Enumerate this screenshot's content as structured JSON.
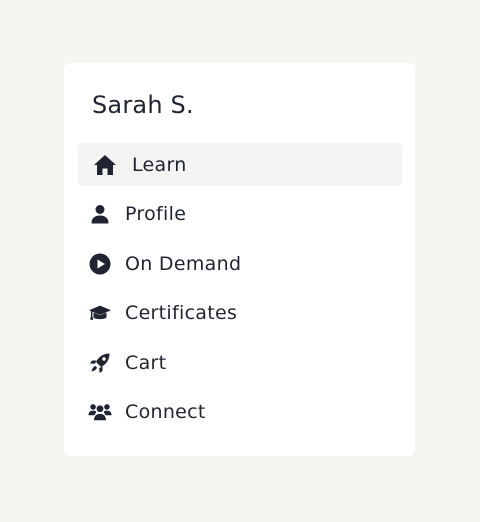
{
  "user": {
    "name": "Sarah S."
  },
  "menu": {
    "items": [
      {
        "label": "Learn",
        "icon": "home-icon",
        "active": true
      },
      {
        "label": "Profile",
        "icon": "user-icon",
        "active": false
      },
      {
        "label": "On Demand",
        "icon": "play-circle-icon",
        "active": false
      },
      {
        "label": "Certificates",
        "icon": "graduation-cap-icon",
        "active": false
      },
      {
        "label": "Cart",
        "icon": "rocket-icon",
        "active": false
      },
      {
        "label": "Connect",
        "icon": "users-icon",
        "active": false
      }
    ]
  },
  "colors": {
    "background": "#f6f5f2",
    "card": "#ffffff",
    "text": "#1f2430",
    "active_item_bg": "#f4f4f2"
  }
}
